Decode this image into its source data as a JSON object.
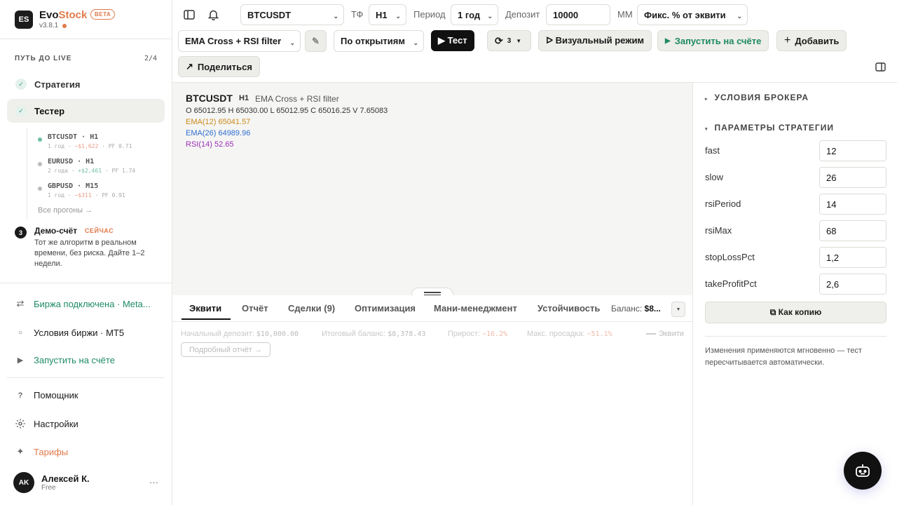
{
  "app": {
    "logo": "ES",
    "brand_a": "Evo",
    "brand_b": "Stock",
    "beta": "BETA",
    "version": "v3.8.1"
  },
  "path": {
    "title": "ПУТЬ ДО LIVE",
    "count": "2/4",
    "steps": [
      {
        "label": "Стратегия",
        "done": true
      },
      {
        "label": "Тестер",
        "done": true,
        "active": true
      }
    ],
    "runs": [
      {
        "title": "BTCUSDT · H1",
        "period": "1 год",
        "pnl": "−$1,622",
        "pf": "PF 0.71",
        "active": true
      },
      {
        "title": "EURUSD · H1",
        "period": "2 года",
        "pnl": "+$2,461",
        "pf": "PF 1.74"
      },
      {
        "title": "GBPUSD · M15",
        "period": "1 год",
        "pnl": "−$311",
        "pf": "PF 0.91"
      }
    ],
    "all_runs": "Все прогоны →",
    "demo": {
      "num": "3",
      "title": "Демо-счёт",
      "badge": "СЕЙЧАС",
      "desc": "Тот же алгоритм в реальном времени, без риска. Дайте 1–2 недели."
    }
  },
  "nav": {
    "exchange": "Биржа подключена · Meta...",
    "conditions": "Условия биржи · MT5",
    "run_live": "Запустить на счёте",
    "helper": "Помощник",
    "settings": "Настройки",
    "plans": "Тарифы"
  },
  "user": {
    "initials": "AK",
    "name": "Алексей К.",
    "plan": "Free",
    "more": "···"
  },
  "toolbar": {
    "symbol": "BTCUSDT",
    "tf_label": "ТФ",
    "tf": "H1",
    "period_label": "Период",
    "period": "1 год",
    "deposit_label": "Депозит",
    "deposit": "10000",
    "mm_label": "MM",
    "mm": "Фикс. % от эквити",
    "strategy": "EMA Cross + RSI filter",
    "fill_mode": "По открытиям",
    "test": "▶ Тест",
    "refresh_count": "3",
    "visual": "ᐅ Визуальный режим",
    "run_live": "Запустить на счёте",
    "add": "Добавить",
    "share": "Поделиться"
  },
  "chart": {
    "symbol": "BTCUSDT",
    "tf": "H1",
    "strategy": "EMA Cross + RSI filter",
    "ohlc": "O 65012.95 H 65030.00 L 65012.95 C 65016.25 V 7.65083",
    "ema12": "EMA(12) 65041.57",
    "ema26": "EMA(26) 64989.96",
    "rsi": "RSI(14) 52.65",
    "colors": {
      "ema12": "#c98a1a",
      "ema26": "#2f6fcf",
      "rsi": "#9a2fb8"
    }
  },
  "tabs": {
    "items": [
      "Эквити",
      "Отчёт",
      "Сделки (9)",
      "Оптимизация",
      "Мани-менеджмент",
      "Устойчивость"
    ],
    "active": "Эквити",
    "balance_label": "Баланс:",
    "balance_value": "$8..."
  },
  "stats": {
    "start_label": "Начальный депозит:",
    "start": "$10,000.00",
    "final_label": "Итоговый баланс:",
    "final": "$8,378.43",
    "growth_label": "Прирост:",
    "growth": "−16.2%",
    "dd_label": "Макс. просадка:",
    "dd": "−51.1%",
    "legend": "Эквити",
    "report_btn": "Подробный отчёт →"
  },
  "right": {
    "broker": "УСЛОВИЯ БРОКЕРА",
    "params_title": "ПАРАМЕТРЫ СТРАТЕГИИ",
    "params": [
      {
        "name": "fast",
        "value": "12"
      },
      {
        "name": "slow",
        "value": "26"
      },
      {
        "name": "rsiPeriod",
        "value": "14"
      },
      {
        "name": "rsiMax",
        "value": "68"
      },
      {
        "name": "stopLossPct",
        "value": "1,2"
      },
      {
        "name": "takeProfitPct",
        "value": "2,6"
      }
    ],
    "copy": "⧉ Как копию",
    "note": "Изменения применяются мгновенно — тест пересчитывается автоматически."
  }
}
